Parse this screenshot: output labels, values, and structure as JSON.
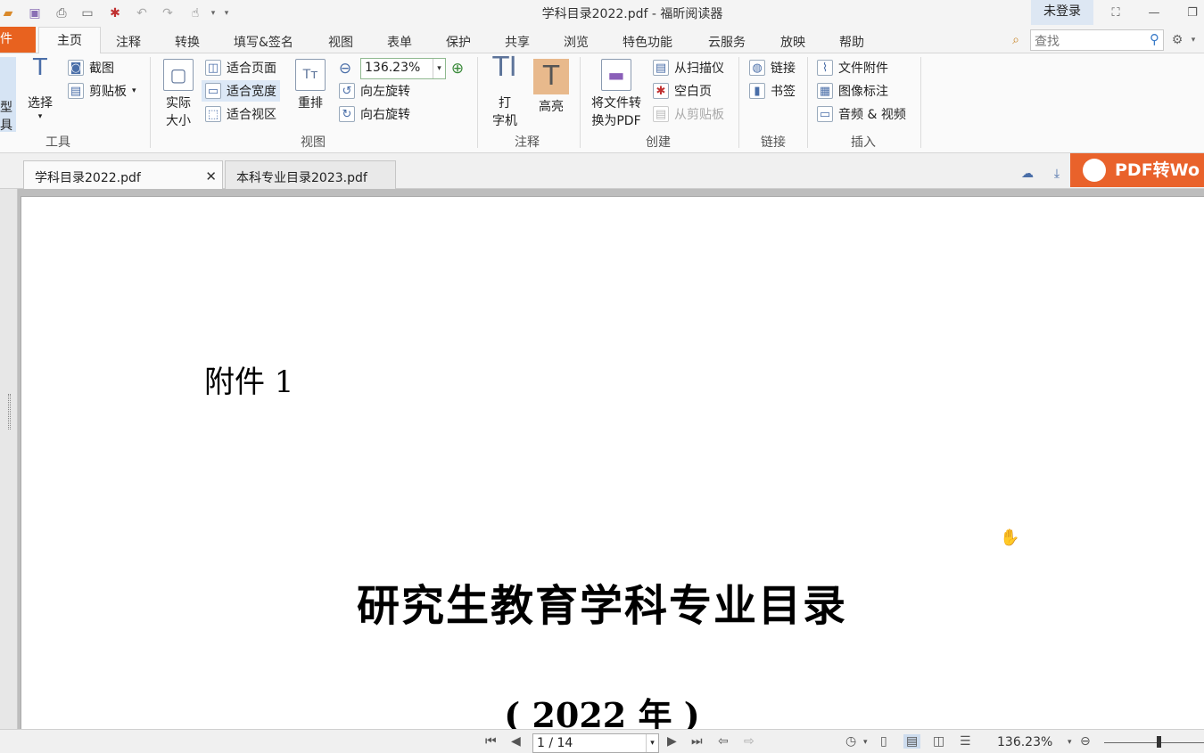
{
  "window": {
    "title": "学科目录2022.pdf - 福昕阅读器",
    "login_label": "未登录"
  },
  "ribbon_tabs": {
    "file": "件",
    "active": "主页",
    "others": [
      "注释",
      "转换",
      "填写&签名",
      "视图",
      "表单",
      "保护",
      "共享",
      "浏览",
      "特色功能",
      "云服务",
      "放映",
      "帮助"
    ]
  },
  "search": {
    "placeholder": "查找"
  },
  "ribbon": {
    "tools": {
      "hand_label_1": "型",
      "hand_label_2": "具",
      "select": "选择",
      "screenshot": "截图",
      "clipboard": "剪贴板",
      "group": "工具"
    },
    "view": {
      "actual_size_1": "实际",
      "actual_size_2": "大小",
      "fit_page": "适合页面",
      "fit_width": "适合宽度",
      "fit_view": "适合视区",
      "reflow": "重排",
      "zoom_value": "136.23%",
      "rotate_left": "向左旋转",
      "rotate_right": "向右旋转",
      "group": "视图"
    },
    "annotate": {
      "typewriter_1": "打",
      "typewriter_2": "字机",
      "highlight": "高亮",
      "group": "注释"
    },
    "create": {
      "convert_1": "将文件转",
      "convert_2": "换为PDF",
      "from_scanner": "从扫描仪",
      "blank_page": "空白页",
      "from_clipboard": "从剪贴板",
      "group": "创建"
    },
    "links": {
      "link": "链接",
      "bookmark": "书签",
      "group": "链接"
    },
    "insert": {
      "file_attachment": "文件附件",
      "image_annotation": "图像标注",
      "audio_video": "音频 & 视频",
      "group": "插入"
    }
  },
  "doc_tabs": [
    {
      "label": "学科目录2022.pdf"
    },
    {
      "label": "本科专业目录2023.pdf"
    }
  ],
  "pdf_to_word": "PDF转Wo",
  "document": {
    "attachment": "附件 1",
    "title": "研究生教育学科专业目录",
    "year": "( 2022 年 )"
  },
  "statusbar": {
    "page": "1 / 14",
    "zoom": "136.23%"
  }
}
